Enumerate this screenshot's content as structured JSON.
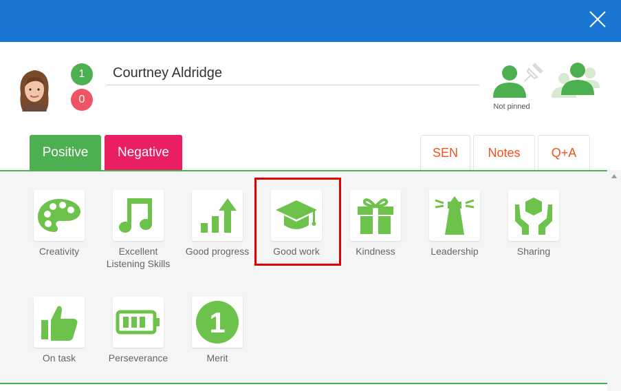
{
  "colors": {
    "topbar": "#1976d2",
    "positive": "#4caf50",
    "negative": "#e91e63",
    "icon_green": "#6cc24a",
    "accent_orange": "#f4511e",
    "highlight": "#e00000"
  },
  "header": {
    "close_icon": "close-icon",
    "student_name": "Courtney Aldridge",
    "positive_count": "1",
    "negative_count": "0",
    "pin_status": "Not pinned"
  },
  "tabs": {
    "positive": "Positive",
    "negative": "Negative",
    "sen": "SEN",
    "notes": "Notes",
    "qa": "Q+A"
  },
  "behaviours": [
    {
      "label": "Creativity",
      "icon": "palette-icon"
    },
    {
      "label": "Excellent Listening Skills",
      "icon": "music-note-icon"
    },
    {
      "label": "Good progress",
      "icon": "bar-chart-up-icon"
    },
    {
      "label": "Good work",
      "icon": "graduation-cap-icon",
      "highlighted": true
    },
    {
      "label": "Kindness",
      "icon": "gift-icon"
    },
    {
      "label": "Leadership",
      "icon": "lighthouse-icon"
    },
    {
      "label": "Sharing",
      "icon": "hands-box-icon"
    },
    {
      "label": "On task",
      "icon": "thumbs-up-icon"
    },
    {
      "label": "Perseverance",
      "icon": "battery-icon"
    },
    {
      "label": "Merit",
      "icon": "merit-one-icon",
      "value": "1"
    }
  ]
}
